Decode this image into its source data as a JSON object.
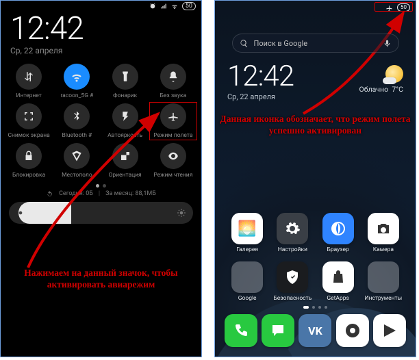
{
  "left": {
    "time": "12:42",
    "date": "Ср, 22 апреля",
    "battery_pct": "50",
    "tiles": [
      {
        "id": "internet",
        "label": "Интернет",
        "icon": "data-arrows"
      },
      {
        "id": "wifi",
        "label": "racoon_5G #",
        "icon": "wifi",
        "on": true
      },
      {
        "id": "flashlight",
        "label": "Фонарик",
        "icon": "flashlight"
      },
      {
        "id": "mute",
        "label": "Без звука",
        "icon": "bell"
      },
      {
        "id": "screenshot",
        "label": "Снимок экрана",
        "icon": "screenshot"
      },
      {
        "id": "bluetooth",
        "label": "Bluetooth #",
        "icon": "bluetooth"
      },
      {
        "id": "autobright",
        "label": "Автояркость",
        "icon": "autobright"
      },
      {
        "id": "airplane",
        "label": "Режим полета",
        "icon": "airplane",
        "highlight": true
      },
      {
        "id": "lock",
        "label": "Блокировка",
        "icon": "lock"
      },
      {
        "id": "location",
        "label": "Местополо",
        "icon": "location"
      },
      {
        "id": "orientation",
        "label": "Ориентация",
        "icon": "orientation"
      },
      {
        "id": "reading",
        "label": "Режим чтения",
        "icon": "eye"
      }
    ],
    "usage_today_label": "Сегодня: 0Б",
    "usage_month_label": "За месяц: 88,1МБ",
    "caption": "Нажимаем на данный значок, чтобы активировать авиарежим"
  },
  "right": {
    "battery_pct": "50",
    "search_placeholder": "Поиск в Google",
    "time": "12:42",
    "date": "Ср, 22 апреля",
    "weather_cond": "Облачно",
    "weather_temp": "7°C",
    "apps_row1": [
      {
        "id": "gallery",
        "label": "Галерея",
        "bg": "#fff",
        "sym": "🌅"
      },
      {
        "id": "settings",
        "label": "Настройки",
        "bg": "#3a3f46",
        "svg": "gear"
      },
      {
        "id": "browser",
        "label": "Браузер",
        "bg": "#2f84ff",
        "svg": "globe"
      },
      {
        "id": "camera",
        "label": "Камера",
        "bg": "#fff",
        "svg": "camera"
      }
    ],
    "apps_row2": [
      {
        "id": "google-folder",
        "label": "Google",
        "folder": [
          "#ea4335",
          "#4285f4",
          "#0f9d58",
          "#db4437",
          "#f4b400",
          "#4285f4",
          "#3ddc84",
          "#ea4335",
          "#34a853"
        ]
      },
      {
        "id": "security",
        "label": "Безопасность",
        "bg": "#1a1c1f",
        "svg": "shield"
      },
      {
        "id": "getapps",
        "label": "GetApps",
        "bg": "#fff",
        "svg": "bag"
      },
      {
        "id": "tools-folder",
        "label": "Инструменты",
        "folder": [
          "#2f84ff",
          "#3a3f46",
          "#ff5a5f",
          "#0b8f4f",
          "#e8b200",
          "#2f6fed",
          "#ff7a00",
          "#22b8cf",
          "#7950f2"
        ]
      }
    ],
    "dock": [
      {
        "id": "phone",
        "bg": "#28c940",
        "svg": "phone"
      },
      {
        "id": "messages",
        "bg": "#28c940",
        "svg": "chat"
      },
      {
        "id": "vk",
        "bg": "#4a76a8",
        "text": "VK"
      },
      {
        "id": "chrome",
        "bg": "#fff",
        "svg": "chrome"
      },
      {
        "id": "play",
        "bg": "#fff",
        "svg": "play"
      }
    ],
    "caption": "Данная иконка обозначает, что режим полета успешно активирован"
  }
}
